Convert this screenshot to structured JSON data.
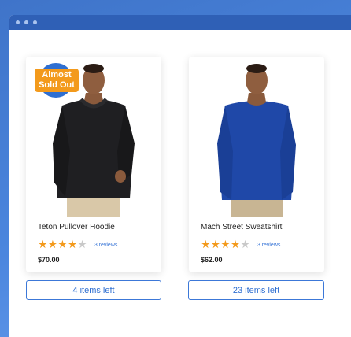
{
  "window": {
    "controls": [
      "dot",
      "dot",
      "dot"
    ]
  },
  "products": [
    {
      "name": "Teton Pullover Hoodie",
      "badge_line1": "Almost",
      "badge_line2": "Sold Out",
      "stars": 4,
      "reviews": "3 reviews",
      "price": "$70.00",
      "stock": "4 items left",
      "garment_color": "#1f1f22"
    },
    {
      "name": "Mach Street Sweatshirt",
      "stars": 4,
      "reviews": "3 reviews",
      "price": "$62.00",
      "stock": "23 items left",
      "garment_color": "#1f48a8"
    }
  ],
  "colors": {
    "accent": "#3c78d8",
    "badge": "#f39a1c",
    "star": "#f39a1c"
  }
}
